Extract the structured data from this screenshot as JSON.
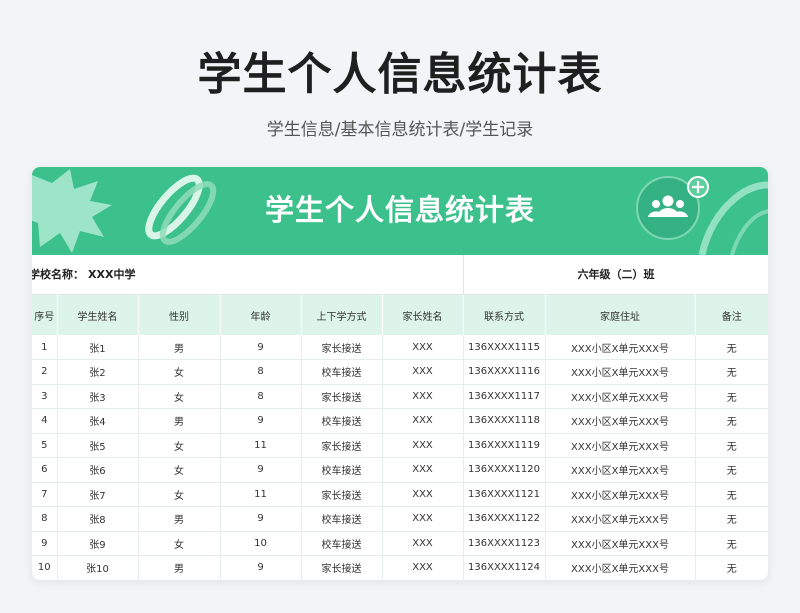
{
  "header": {
    "title": "学生个人信息统计表",
    "subtitle": "学生信息/基本信息统计表/学生记录"
  },
  "card": {
    "banner_title": "学生个人信息统计表",
    "school_label": "学校名称：",
    "school_value": "XXX中学",
    "class_label": "六年级（二）班",
    "accent_color": "#3cc08c",
    "header_bg": "#dcf4ea"
  },
  "icons": {
    "banner_people": "users-icon",
    "banner_plus": "plus-icon"
  },
  "table": {
    "columns": [
      "序号",
      "学生姓名",
      "性别",
      "年龄",
      "上下学方式",
      "家长姓名",
      "联系方式",
      "家庭住址",
      "备注"
    ],
    "rows": [
      [
        "1",
        "张1",
        "男",
        "9",
        "家长接送",
        "XXX",
        "136XXXX1115",
        "XXX小区X单元XXX号",
        "无"
      ],
      [
        "2",
        "张2",
        "女",
        "8",
        "校车接送",
        "XXX",
        "136XXXX1116",
        "XXX小区X单元XXX号",
        "无"
      ],
      [
        "3",
        "张3",
        "女",
        "8",
        "家长接送",
        "XXX",
        "136XXXX1117",
        "XXX小区X单元XXX号",
        "无"
      ],
      [
        "4",
        "张4",
        "男",
        "9",
        "校车接送",
        "XXX",
        "136XXXX1118",
        "XXX小区X单元XXX号",
        "无"
      ],
      [
        "5",
        "张5",
        "女",
        "11",
        "家长接送",
        "XXX",
        "136XXXX1119",
        "XXX小区X单元XXX号",
        "无"
      ],
      [
        "6",
        "张6",
        "女",
        "9",
        "校车接送",
        "XXX",
        "136XXXX1120",
        "XXX小区X单元XXX号",
        "无"
      ],
      [
        "7",
        "张7",
        "女",
        "11",
        "家长接送",
        "XXX",
        "136XXXX1121",
        "XXX小区X单元XXX号",
        "无"
      ],
      [
        "8",
        "张8",
        "男",
        "9",
        "校车接送",
        "XXX",
        "136XXXX1122",
        "XXX小区X单元XXX号",
        "无"
      ],
      [
        "9",
        "张9",
        "女",
        "10",
        "校车接送",
        "XXX",
        "136XXXX1123",
        "XXX小区X单元XXX号",
        "无"
      ],
      [
        "10",
        "张10",
        "男",
        "9",
        "家长接送",
        "XXX",
        "136XXXX1124",
        "XXX小区X单元XXX号",
        "无"
      ]
    ]
  }
}
